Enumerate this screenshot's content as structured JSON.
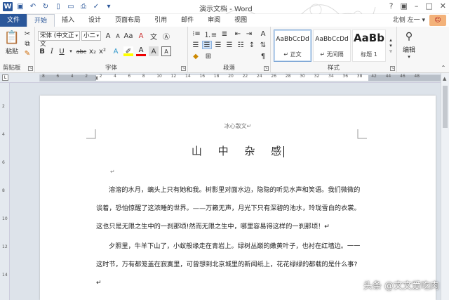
{
  "window": {
    "title": "演示文档 - Word",
    "user": "北侧 左一 ▾"
  },
  "tabs": [
    "文件",
    "开始",
    "插入",
    "设计",
    "页面布局",
    "引用",
    "邮件",
    "审阅",
    "视图"
  ],
  "ribbon": {
    "clipboard": {
      "paste": "粘贴",
      "label": "剪贴板"
    },
    "font": {
      "name": "宋体 (中文正文",
      "size": "小二",
      "label": "字体"
    },
    "paragraph": {
      "label": "段落"
    },
    "styles": {
      "label": "样式",
      "items": [
        {
          "preview": "AaBbCcDd",
          "name": "↵ 正文"
        },
        {
          "preview": "AaBbCcDd",
          "name": "↵ 无间隔"
        },
        {
          "preview": "AaBb",
          "name": "标题 1"
        }
      ]
    },
    "editing": {
      "label": "编辑"
    }
  },
  "ruler": {
    "ticks": [
      "8",
      "6",
      "4",
      "2",
      "2",
      "4",
      "6",
      "8",
      "10",
      "12",
      "14",
      "16",
      "18",
      "20",
      "22",
      "24",
      "26",
      "28",
      "30",
      "32",
      "34",
      "36",
      "38",
      "42",
      "44",
      "46",
      "48"
    ]
  },
  "vruler": {
    "ticks": [
      "2",
      "4",
      "6",
      "8",
      "10",
      "12",
      "14"
    ]
  },
  "document": {
    "header": "冰心散文↵",
    "title": "山 中 杂 感",
    "empty_mark": "↵",
    "paragraphs": [
      "溶溶的水月，螭头上只有她和我。树影里对面水边，隐隐的听见水声和笑语。我们微微的谈着，恐怕惊醒了这浓睡的世界。——万籁无声，月光下只有深碧的池水，玲珑雪白的衣裳。这也只是无限之生中的一刹那顷!然而无限之生中，哪里容易得这样的一刹那顷！↵",
      "夕照里，牛羊下山了，小蚁般缘走在青岩上。绿树丛巅的嫩黄叶子，也衬在红墙边。一一这时节，万有都笼盖在寂寞里，可曾想到北京城里的新闻纸上，花花绿绿的都载的是什么事?↵"
    ]
  },
  "watermark": "头条 @文文爱吃肉"
}
